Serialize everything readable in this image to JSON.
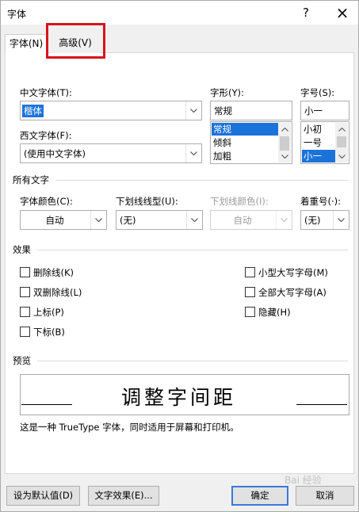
{
  "window": {
    "title": "字体",
    "help_icon": "?",
    "close_icon": "×"
  },
  "tabs": [
    {
      "label": "字体(N)",
      "active": true
    },
    {
      "label": "高级(V)",
      "active": false,
      "highlighted": true
    }
  ],
  "font": {
    "chinese_label": "中文字体(T):",
    "chinese_value": "楷体",
    "western_label": "西文字体(F):",
    "western_value": "(使用中文字体)",
    "style_label": "字形(Y):",
    "style_value": "常规",
    "style_options": [
      "常规",
      "倾斜",
      "加粗"
    ],
    "style_selected_index": 0,
    "size_label": "字号(S):",
    "size_value": "小一",
    "size_options": [
      "小初",
      "一号",
      "小一"
    ],
    "size_selected_index": 2
  },
  "all_text": {
    "section_label": "所有文字",
    "color_label": "字体颜色(C):",
    "color_value": "自动",
    "underline_label": "下划线线型(U):",
    "underline_value": "(无)",
    "underline_color_label": "下划线颜色(I):",
    "underline_color_value": "自动",
    "underline_color_enabled": false,
    "emphasis_label": "着重号(·):",
    "emphasis_value": "(无)"
  },
  "effects": {
    "section_label": "效果",
    "left": [
      {
        "label": "删除线(K)",
        "checked": false
      },
      {
        "label": "双删除线(L)",
        "checked": false
      },
      {
        "label": "上标(P)",
        "checked": false
      },
      {
        "label": "下标(B)",
        "checked": false
      }
    ],
    "right": [
      {
        "label": "小型大写字母(M)",
        "checked": false
      },
      {
        "label": "全部大写字母(A)",
        "checked": false
      },
      {
        "label": "隐藏(H)",
        "checked": false
      }
    ]
  },
  "preview": {
    "section_label": "预览",
    "sample_text": "调整字间距",
    "note": "这是一种 TrueType 字体，同时适用于屏幕和打印机。"
  },
  "buttons": {
    "set_default": "设为默认值(D)",
    "text_effects": "文字效果(E)...",
    "ok": "确定",
    "cancel": "取消"
  },
  "watermark": "Bai 经验",
  "colors": {
    "selection": "#1a73d9",
    "highlight_box": "#d9131c",
    "default_button_border": "#3b78d8"
  }
}
